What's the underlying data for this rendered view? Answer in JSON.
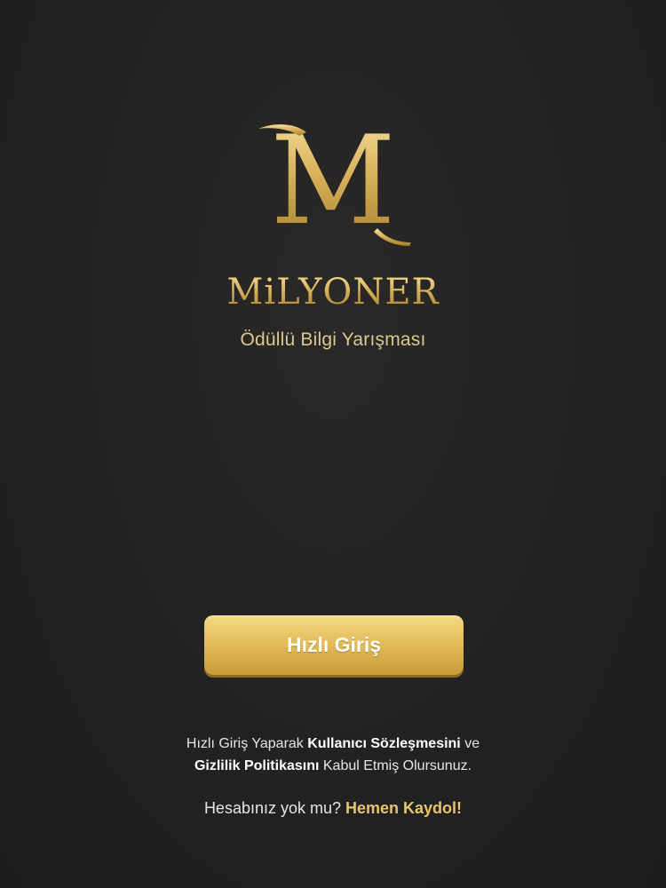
{
  "brand": {
    "logo_letter": "M",
    "wordmark": "MiLYONER",
    "tagline": "Ödüllü Bilgi Yarışması",
    "gold": "#e4bd5b"
  },
  "login": {
    "quick_login_label": "Hızlı Giriş"
  },
  "terms": {
    "part1": "Hızlı Giriş Yaparak ",
    "user_agreement": "Kullanıcı Sözleşmesini",
    "part2": " ve",
    "privacy_policy": "Gizlilik Politikasını",
    "part3": " Kabul Etmiş Olursunuz."
  },
  "signup": {
    "prompt": "Hesabınız yok mu? ",
    "link": "Hemen Kaydol!"
  }
}
